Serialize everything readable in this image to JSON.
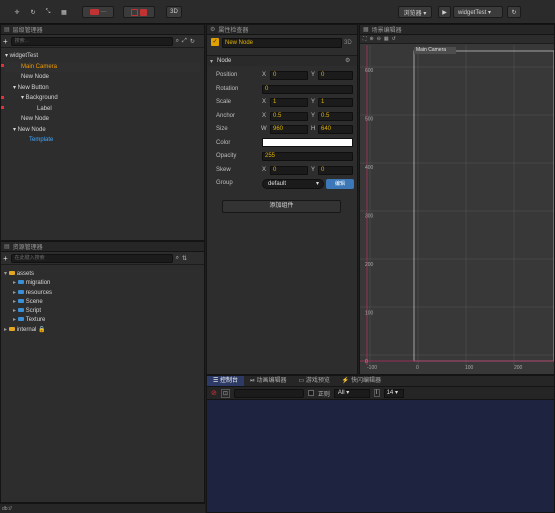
{
  "toolbar": {
    "move_icon": "✛",
    "rotate_icon": "↻",
    "scale_icon": "⤡",
    "rect_icon": "▦",
    "local_label": "",
    "dash_label": "—",
    "three_d_label": "3D",
    "browser_label": "浏览器 ▾",
    "play_icon": "▶",
    "scene_name": "widgetTest ▾",
    "refresh_icon": "↻"
  },
  "hierarchy": {
    "title": "层级管理器",
    "search_placeholder": "搜索...",
    "nodes": [
      {
        "label": "▾ widgetTest",
        "color": "#d4d4d4",
        "indent": 0
      },
      {
        "label": "Main Camera",
        "color": "#f29a00",
        "indent": 1
      },
      {
        "label": "New Node",
        "color": "#d4d4d4",
        "indent": 1
      },
      {
        "label": "▾ New Button",
        "color": "#d4d4d4",
        "indent": 1
      },
      {
        "label": "▾ Background",
        "color": "#d4d4d4",
        "indent": 2
      },
      {
        "label": "Label",
        "color": "#d4d4d4",
        "indent": 3
      },
      {
        "label": "New Node",
        "color": "#d4d4d4",
        "indent": 1
      },
      {
        "label": "▾ New Node",
        "color": "#d4d4d4",
        "indent": 1
      },
      {
        "label": "Template",
        "color": "#43a7ff",
        "indent": 2
      }
    ]
  },
  "assets": {
    "title": "资源管理器",
    "search_placeholder": "在此键入搜索",
    "items": [
      {
        "label": "assets",
        "indent": 0,
        "arrow": "▾"
      },
      {
        "label": "migration",
        "indent": 1,
        "arrow": "▸"
      },
      {
        "label": "resources",
        "indent": 1,
        "arrow": "▸"
      },
      {
        "label": "Scene",
        "indent": 1,
        "arrow": "▸"
      },
      {
        "label": "Script",
        "indent": 1,
        "arrow": "▸"
      },
      {
        "label": "Texture",
        "indent": 1,
        "arrow": "▸"
      },
      {
        "label": "internal 🔒",
        "indent": 0,
        "arrow": "▸"
      }
    ],
    "footer": "db://"
  },
  "inspector": {
    "title": "属性检查器",
    "node_name": "New Node",
    "three_d": "3D",
    "section": "Node",
    "position": {
      "label": "Position",
      "x": "0",
      "y": "0"
    },
    "rotation": {
      "label": "Rotation",
      "value": "0"
    },
    "scale": {
      "label": "Scale",
      "x": "1",
      "y": "1"
    },
    "anchor": {
      "label": "Anchor",
      "x": "0.5",
      "y": "0.5"
    },
    "size": {
      "label": "Size",
      "w": "960",
      "h": "640"
    },
    "color": {
      "label": "Color",
      "value": "#ffffff"
    },
    "opacity": {
      "label": "Opacity",
      "value": "255"
    },
    "skew": {
      "label": "Skew",
      "x": "0",
      "y": "0"
    },
    "group": {
      "label": "Group",
      "value": "default",
      "edit": "编辑"
    },
    "add_component": "添加组件",
    "x_label": "X",
    "y_label": "Y",
    "w_label": "W",
    "h_label": "H"
  },
  "scene": {
    "title": "场景编辑器",
    "camera_label": "Main Camera",
    "y_ticks": [
      "600",
      "500",
      "400",
      "300",
      "200",
      "100",
      "0"
    ],
    "x_ticks": [
      "-100",
      "0",
      "100",
      "200"
    ]
  },
  "console": {
    "tabs": [
      "控制台",
      "动画编辑器",
      "游戏预览",
      "快闪编辑器"
    ],
    "regex_label": "正则",
    "filter_value": "All",
    "font_label": "14"
  }
}
